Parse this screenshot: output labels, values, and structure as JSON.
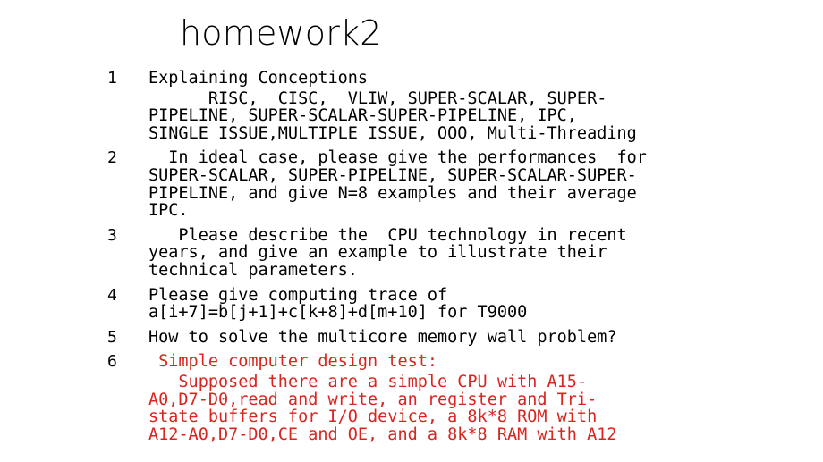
{
  "document": {
    "title": "homework2",
    "background_color": "#ffffff",
    "text_color": "#000000",
    "accent_color": "#d9241f"
  },
  "items": [
    {
      "number": "1",
      "heading": "Explaining Conceptions",
      "heading_color": "#000000",
      "paragraph": "      RISC,  CISC,  VLIW, SUPER-SCALAR, SUPER-\nPIPELINE, SUPER-SCALAR-SUPER-PIPELINE, IPC,\nSINGLE ISSUE,MULTIPLE ISSUE, OOO, Multi-Threading",
      "paragraph_color": "#000000"
    },
    {
      "number": "2",
      "heading": "  In ideal case, please give the performances  for\nSUPER-SCALAR, SUPER-PIPELINE, SUPER-SCALAR-SUPER-\nPIPELINE, and give N=8 examples and their average\nIPC.",
      "heading_color": "#000000",
      "paragraph": "",
      "paragraph_color": "#000000"
    },
    {
      "number": "3",
      "heading": "   Please describe the  CPU technology in recent\nyears, and give an example to illustrate their\ntechnical parameters.",
      "heading_color": "#000000",
      "paragraph": "",
      "paragraph_color": "#000000"
    },
    {
      "number": "4",
      "heading": "Please give computing trace of\na[i+7]=b[j+1]+c[k+8]+d[m+10] for T9000",
      "heading_color": "#000000",
      "paragraph": "",
      "paragraph_color": "#000000"
    },
    {
      "number": "5",
      "heading": "How to solve the multicore memory wall problem?",
      "heading_color": "#000000",
      "paragraph": "",
      "paragraph_color": "#000000"
    },
    {
      "number": "6",
      "heading": " Simple computer design test:",
      "heading_color": "#d9241f",
      "paragraph": "   Supposed there are a simple CPU with A15-\nA0,D7-D0,read and write, an register and Tri-\nstate buffers for I/O device, a 8k*8 ROM with\nA12-A0,D7-D0,CE and OE, and a 8k*8 RAM with A12",
      "paragraph_color": "#d9241f"
    }
  ]
}
